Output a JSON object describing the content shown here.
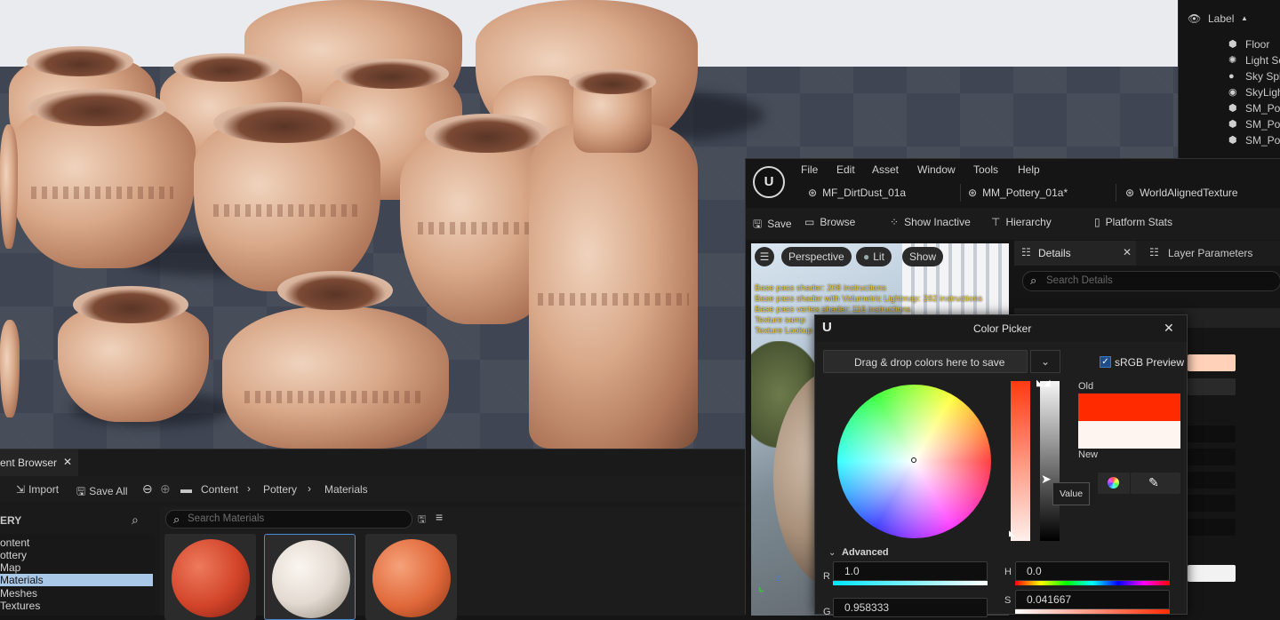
{
  "outliner": {
    "header_label": "Label",
    "items": [
      {
        "label": "Floor",
        "icon": "mesh-icon"
      },
      {
        "label": "Light So",
        "icon": "light-icon"
      },
      {
        "label": "Sky Sph",
        "icon": "sphere-icon"
      },
      {
        "label": "SkyLigh",
        "icon": "skylight-icon"
      },
      {
        "label": "SM_Pot",
        "icon": "mesh-icon"
      },
      {
        "label": "SM_Pot",
        "icon": "mesh-icon"
      },
      {
        "label": "SM_Pot",
        "icon": "mesh-icon"
      }
    ]
  },
  "material_editor": {
    "menu": [
      "File",
      "Edit",
      "Asset",
      "Window",
      "Tools",
      "Help"
    ],
    "asset_tabs": [
      "MF_DirtDust_01a",
      "MM_Pottery_01a*",
      "WorldAlignedTexture"
    ],
    "toolbar": {
      "save": "Save",
      "browse": "Browse",
      "show_inactive": "Show Inactive",
      "hierarchy": "Hierarchy",
      "platform_stats": "Platform Stats"
    },
    "preview": {
      "perspective": "Perspective",
      "lit": "Lit",
      "show": "Show",
      "stats": [
        "Base pass shader: 208 instructions",
        "Base pass shader with Volumetric Lightmap: 282 instructions",
        "Base pass vertex shader: 116 instructions",
        "Texture samp",
        "Texture Lookup"
      ]
    },
    "details_tab": "Details",
    "layer_parameters_tab": "Layer Parameters",
    "search_details_placeholder": "Search Details"
  },
  "color_picker": {
    "title": "Color Picker",
    "drop_zone": "Drag & drop colors here to save",
    "srgb_preview": "sRGB Preview",
    "srgb_checked": true,
    "old_label": "Old",
    "new_label": "New",
    "old_color": "#ff2a00",
    "new_color": "#fff5f0",
    "tooltip": "Value",
    "advanced": "Advanced",
    "fields": {
      "r_label": "R",
      "r_value": "1.0",
      "g_label": "G",
      "g_value": "0.958333",
      "h_label": "H",
      "h_value": "0.0",
      "s_label": "S",
      "s_value": "0.041667"
    }
  },
  "content_browser": {
    "tab_label": "ent Browser",
    "import": "Import",
    "save_all": "Save All",
    "breadcrumb": [
      "Content",
      "Pottery",
      "Materials"
    ],
    "tree_header": "ERY",
    "tree": [
      "ontent",
      "ottery",
      "Map",
      "Materials",
      "Meshes",
      "Textures"
    ],
    "selected_tree_item": "Materials",
    "search_placeholder": "Search Materials",
    "thumbnails": [
      {
        "name": "red-material",
        "color": "#d2442a"
      },
      {
        "name": "white-material",
        "color": "#e3dbd2"
      },
      {
        "name": "orange-material",
        "color": "#e0683a"
      }
    ]
  }
}
